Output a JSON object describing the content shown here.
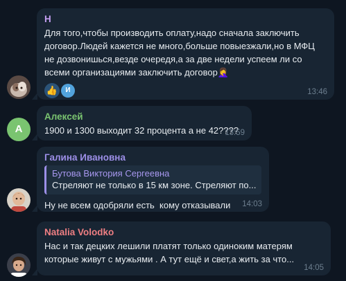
{
  "messages": [
    {
      "sender": "Н",
      "sender_color": "#c49ef1",
      "text": "Для того,чтобы производить оплату,надо сначала заключить договор.Людей кажется не много,больше повыезжали,но в МФЦ не дозвонишься,везде очередя,а за две недели успеем ли со всеми организациями заключить договор🤦‍♀️",
      "reactions": {
        "emoji": "👍",
        "avatar_letter": "И"
      },
      "time": "13:46"
    },
    {
      "sender": "Алексей",
      "sender_color": "#7ac470",
      "avatar_letter": "А",
      "text": "1900 и 1300 выходит 32 процента а не 42????",
      "time": "13:59"
    },
    {
      "sender": "Галина Ивановна",
      "sender_color": "#9d8fe8",
      "reply": {
        "name": "Бутова Виктория Сергеевна",
        "text": "Стреляют не только в 15 км зоне. Стреляют по..."
      },
      "text": "Ну не всем одобряли есть  кому отказывали",
      "time": "14:03"
    },
    {
      "sender": "Natalia Volodko",
      "sender_color": "#ef7f83",
      "text": "Нас и так децких лешили платят только одиноким матерям которые живут с мужьями . А тут ещё и свет,а жить за что...",
      "time": "14:05"
    }
  ]
}
